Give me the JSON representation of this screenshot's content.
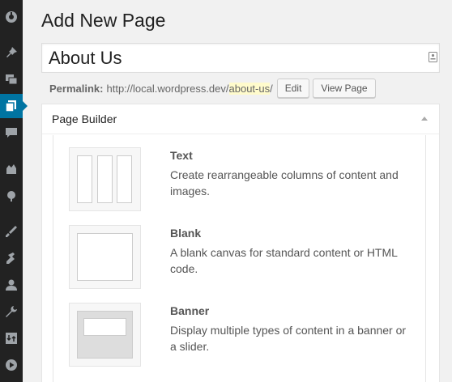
{
  "header": {
    "title": "Add New Page"
  },
  "post_title": {
    "value": "About Us"
  },
  "permalink": {
    "label": "Permalink:",
    "base": "http://local.wordpress.dev/",
    "slug": "about-us",
    "trail": "/",
    "edit_label": "Edit",
    "view_label": "View Page"
  },
  "page_builder": {
    "title": "Page Builder",
    "layouts": [
      {
        "name": "Text",
        "description": "Create rearrangeable columns of content and images."
      },
      {
        "name": "Blank",
        "description": "A blank canvas for standard content or HTML code."
      },
      {
        "name": "Banner",
        "description": "Display multiple types of content in a banner or a slider."
      }
    ]
  },
  "sidebar": {
    "icons": [
      "dashboard-icon",
      "pin-icon",
      "media-icon",
      "pages-icon",
      "comments-icon",
      "appearance-icon",
      "plugins-icon",
      "brush-icon",
      "tools-icon",
      "users-icon",
      "wrench-icon",
      "import-icon",
      "play-icon"
    ],
    "active": "pages-icon"
  },
  "colors": {
    "accent": "#0074a2",
    "sidebar_bg": "#222222",
    "highlight": "#fffbcc"
  }
}
